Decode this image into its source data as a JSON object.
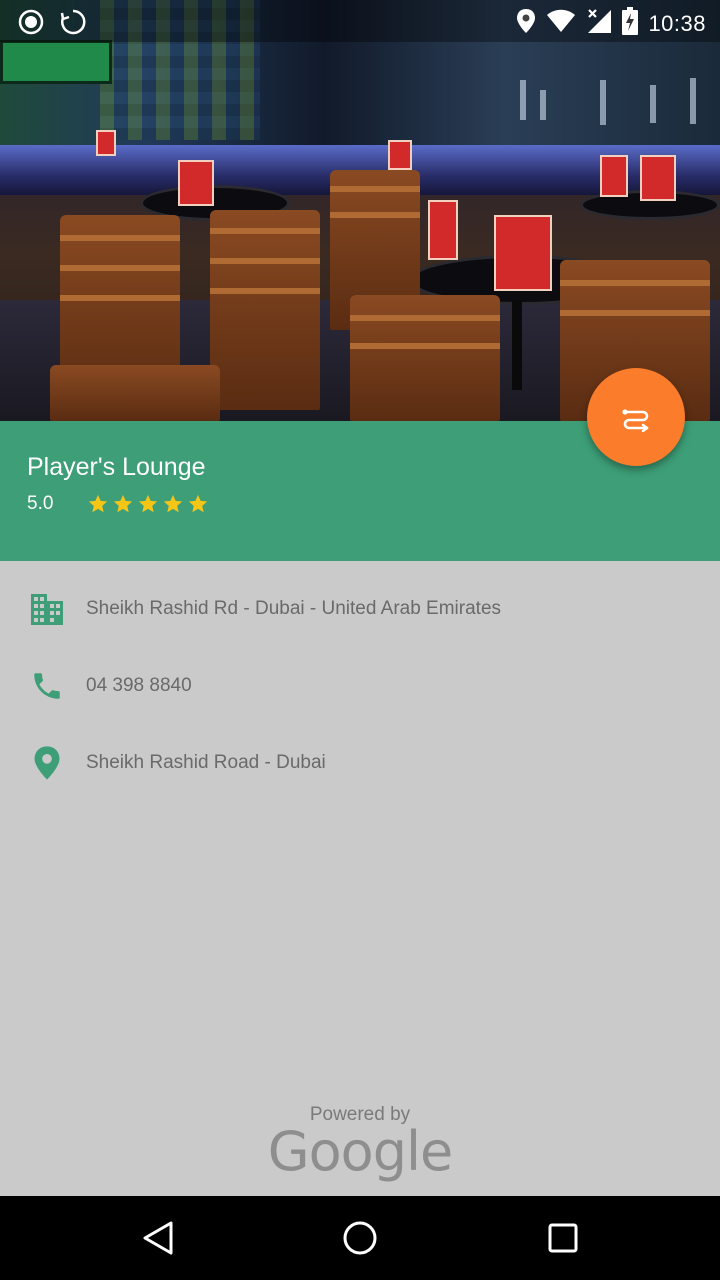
{
  "status_bar": {
    "time": "10:38",
    "left_icons": [
      "record-icon",
      "sync-icon"
    ],
    "right_icons": [
      "location-icon",
      "wifi-icon",
      "signal-icon",
      "battery-charging-icon"
    ]
  },
  "hero": {
    "image": "bar-lounge-interior-photo"
  },
  "place": {
    "name": "Player's Lounge",
    "rating": "5.0",
    "stars_filled": 5,
    "stars_total": 5
  },
  "fab": {
    "icon": "directions-icon"
  },
  "details": [
    {
      "icon": "building-icon",
      "text": "Sheikh Rashid Rd - Dubai - United Arab Emirates"
    },
    {
      "icon": "phone-icon",
      "text": "04 398 8840"
    },
    {
      "icon": "location-pin-icon",
      "text": "Sheikh Rashid Road - Dubai"
    }
  ],
  "attribution": {
    "label": "Powered by",
    "brand": "Google"
  },
  "nav_bar": {
    "icons": [
      "back-icon",
      "home-icon",
      "recents-icon"
    ]
  },
  "colors": {
    "header_green": "#3d9e77",
    "fab_orange": "#fb7c2a",
    "star_yellow": "#f5c518",
    "details_bg": "#cacaca"
  }
}
